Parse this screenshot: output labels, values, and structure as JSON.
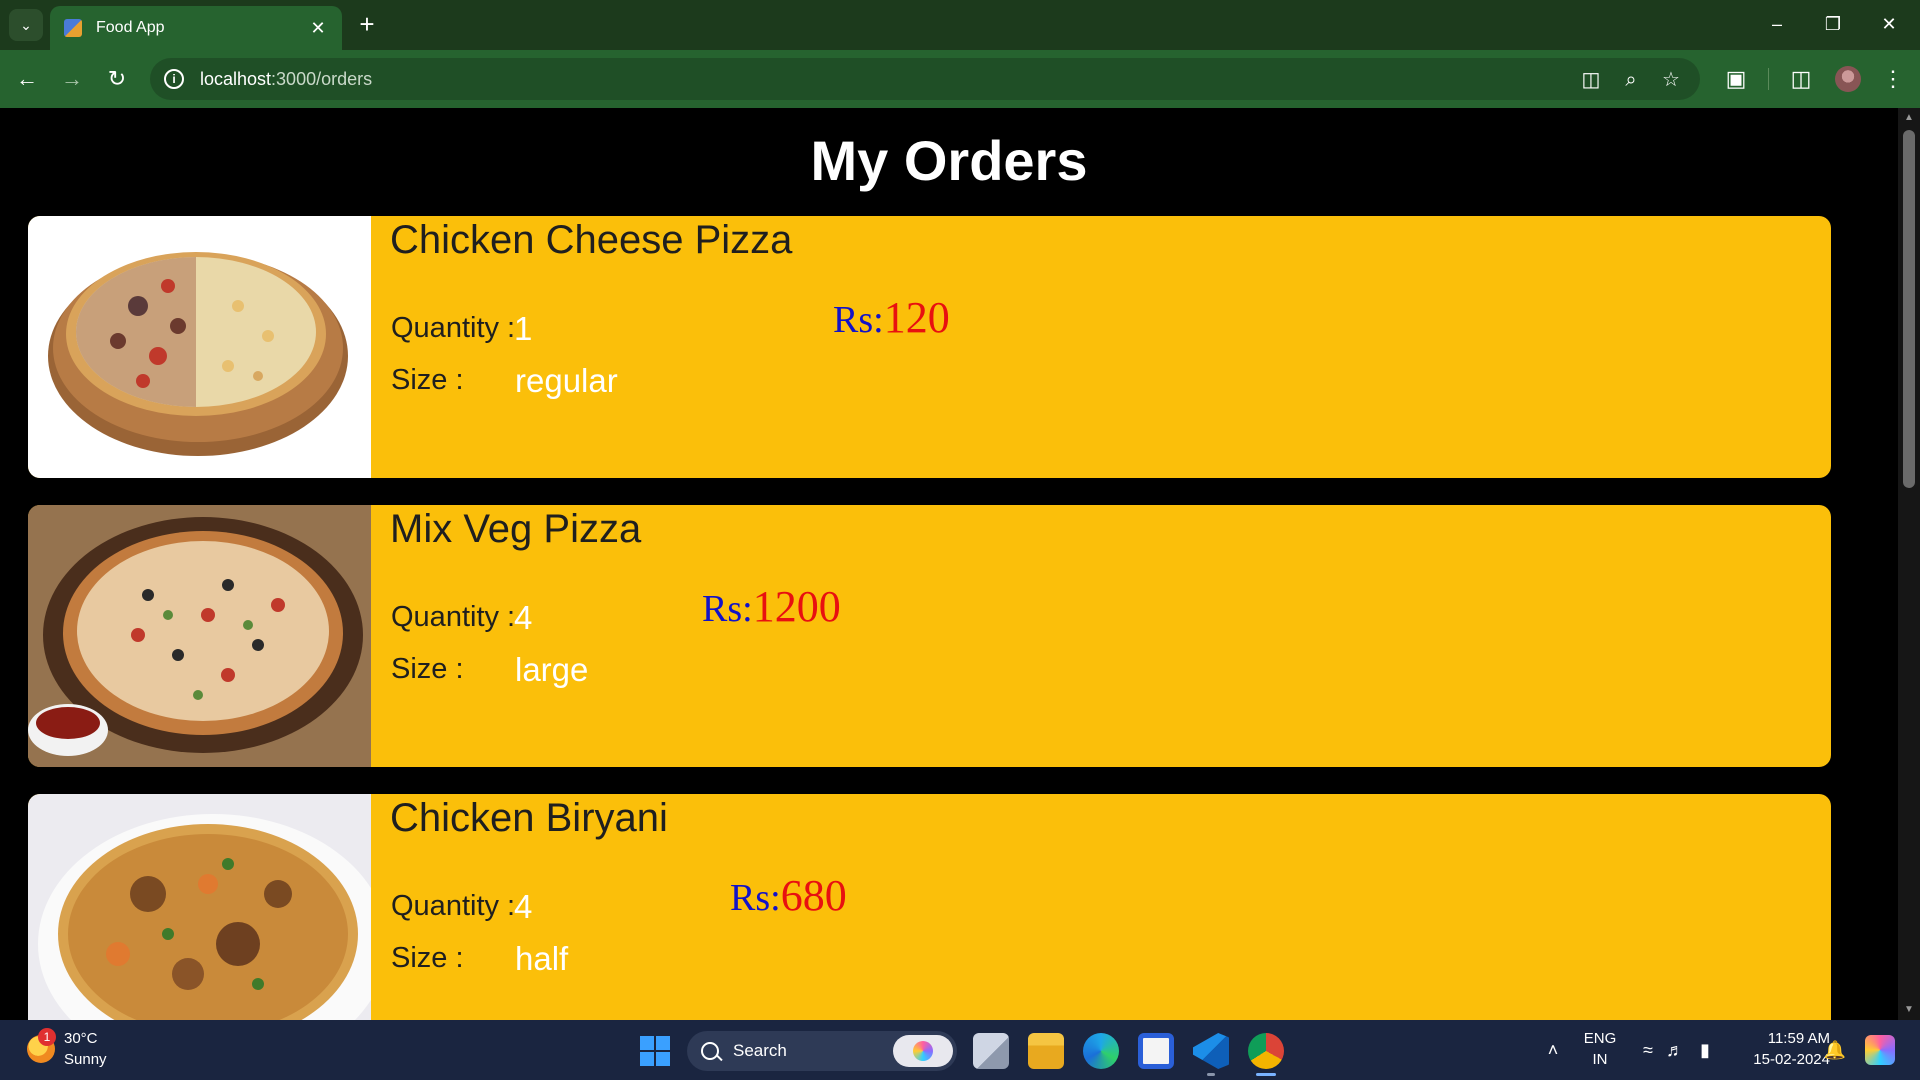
{
  "browser": {
    "tab_title": "Food App",
    "url_host": "localhost",
    "url_path": ":3000/orders"
  },
  "page": {
    "title": "My Orders",
    "orders": [
      {
        "name": "Chicken Cheese Pizza",
        "quantity_label": "Quantity :",
        "quantity": "1",
        "size_label": "Size :",
        "size": "regular",
        "price_label": "Rs:",
        "price": "120",
        "image": "pizza-chicken-cheese"
      },
      {
        "name": "Mix Veg Pizza",
        "quantity_label": "Quantity :",
        "quantity": "4",
        "size_label": "Size :",
        "size": "large",
        "price_label": "Rs:",
        "price": "1200",
        "image": "pizza-mix-veg"
      },
      {
        "name": "Chicken Biryani",
        "quantity_label": "Quantity :",
        "quantity": "4",
        "size_label": "Size :",
        "size": "half",
        "price_label": "Rs:",
        "price": "680",
        "image": "chicken-biryani"
      }
    ]
  },
  "taskbar": {
    "weather_temp": "30°C",
    "weather_desc": "Sunny",
    "weather_badge": "1",
    "search_placeholder": "Search",
    "lang_top": "ENG",
    "lang_bottom": "IN",
    "time": "11:59 AM",
    "date": "15-02-2024"
  },
  "colors": {
    "card_background": "#fbbf0a",
    "price_label": "#1212c8",
    "price_value": "#e81010",
    "chrome_toolbar": "#26632f"
  }
}
